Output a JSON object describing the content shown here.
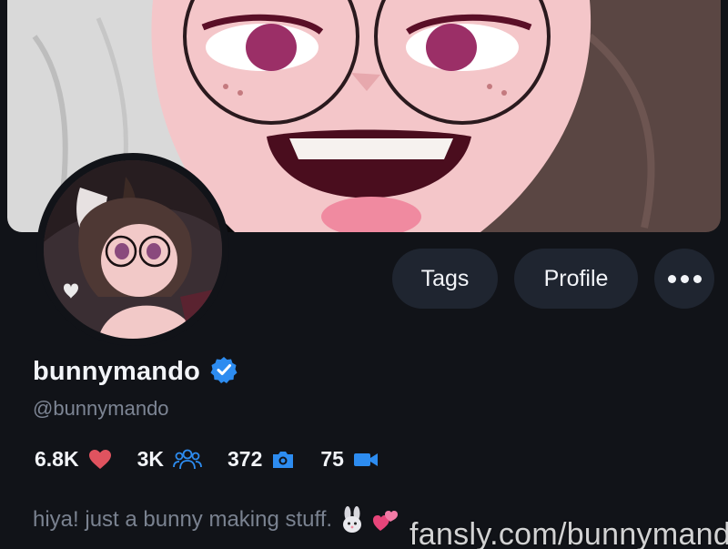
{
  "buttons": {
    "tags": "Tags",
    "profile": "Profile"
  },
  "profile": {
    "display_name": "bunnymando",
    "handle": "@bunnymando",
    "verified": true,
    "bio": "hiya! just a bunny making stuff."
  },
  "stats": [
    {
      "value": "6.8K",
      "icon": "heart-icon"
    },
    {
      "value": "3K",
      "icon": "followers-icon"
    },
    {
      "value": "372",
      "icon": "camera-icon"
    },
    {
      "value": "75",
      "icon": "video-icon"
    }
  ],
  "watermark": "fansly.com/bunnymando",
  "colors": {
    "background": "#111318",
    "button_bg": "#1f2530",
    "accent_blue": "#2d8cf0",
    "heart": "#e0535f",
    "muted_text": "#7d8594"
  }
}
